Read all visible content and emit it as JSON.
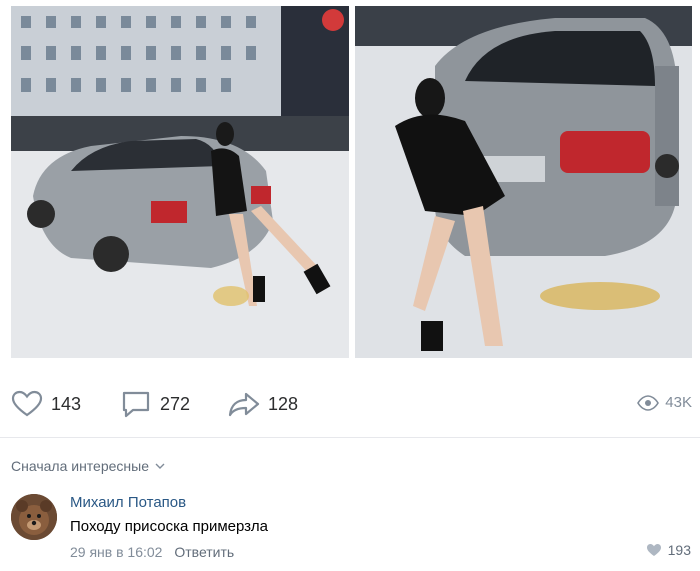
{
  "post": {
    "likes_count": "143",
    "comments_count": "272",
    "shares_count": "128",
    "views_count": "43K"
  },
  "comments_sort": {
    "label": "Сначала интересные"
  },
  "comment": {
    "author": "Михаил Потапов",
    "text": "Походу присоска примерзла",
    "date": "29 янв в 16:02",
    "reply_label": "Ответить",
    "likes": "193"
  },
  "colors": {
    "link": "#2a5885",
    "muted": "#818c99",
    "icon": "#818c99",
    "text": "#000000"
  },
  "icons": [
    "heart-icon",
    "comment-icon",
    "share-icon",
    "eye-icon",
    "chevron-down-icon",
    "small-heart-icon"
  ]
}
